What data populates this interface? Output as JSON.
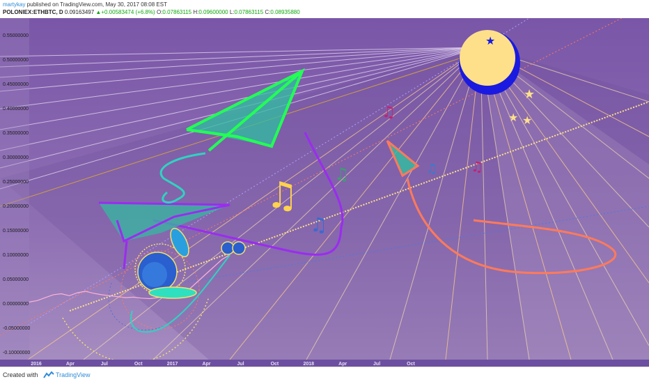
{
  "header": {
    "author": "martykay",
    "published": " published on TradingView.com, May 30, 2017 08:08 EST",
    "symbol": "POLONIEX:ETHBTC, D",
    "last": "0.09163497",
    "change": "+0.00583474 (+6.8%)",
    "o_label": "O:",
    "o_value": "0.07863115",
    "h_label": "H:",
    "h_value": "0.09600000",
    "l_label": "L:",
    "l_value": "0.07863115",
    "c_label": "C:",
    "c_value": "0.08935880"
  },
  "footer": {
    "created_label": "Created with",
    "brand": "TradingView",
    "logo_icon": "tradingview-logo-icon"
  },
  "colors": {
    "background_top": "#7a5aa6",
    "background_bottom": "#9a80b8",
    "axis_bar": "#6c4fa0",
    "neon_green": "#22ff55",
    "teal": "#2fbfa0",
    "purple_stroke": "#9b2cf0",
    "orange_coral": "#ff7a5a",
    "moon_yellow": "#ffe08a",
    "moon_blue": "#1a1ae0",
    "note_yellow": "#ffd34d",
    "price_pink": "#ffb3d9"
  },
  "chart_data": {
    "type": "line",
    "title": "",
    "xlabel": "",
    "ylabel": "",
    "x_ticks": [
      "2016",
      "Apr",
      "Jul",
      "Oct",
      "2017",
      "Apr",
      "Jul",
      "Oct",
      "2018",
      "Apr",
      "Jul",
      "Oct"
    ],
    "y_ticks": [
      "0.55000000",
      "0.50000000",
      "0.45000000",
      "0.40000000",
      "0.35000000",
      "0.30000000",
      "0.25000000",
      "0.20000000",
      "0.15000000",
      "0.10000000",
      "0.05000000",
      "0.00000000",
      "-0.05000000",
      "-0.10000000"
    ],
    "ylim": [
      -0.115,
      0.585
    ],
    "grid": false,
    "series": [
      {
        "values": [
          0.003,
          0.006,
          0.012,
          0.018,
          0.02,
          0.016,
          0.022,
          0.025,
          0.021,
          0.018,
          0.016,
          0.014,
          0.012,
          0.013,
          0.011,
          0.01,
          0.012,
          0.014,
          0.017,
          0.022,
          0.03,
          0.045,
          0.06,
          0.075,
          0.09,
          0.1
        ]
      }
    ]
  },
  "decorations": {
    "moon_icon": "crescent-moon-icon",
    "star_icon": "star-icon",
    "note_icon": "music-note-icon",
    "plane_icon": "paper-plane-icon",
    "sun_rays": "fan-lines"
  }
}
